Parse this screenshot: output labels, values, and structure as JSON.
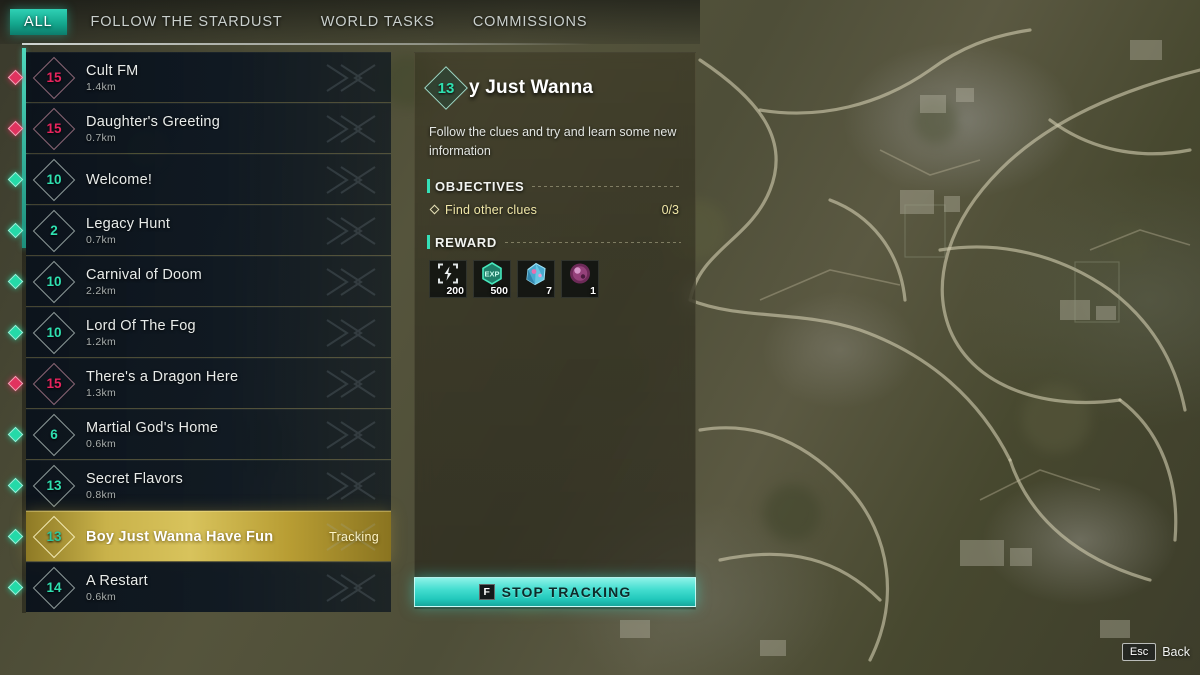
{
  "tabs": [
    {
      "label": "ALL",
      "active": true
    },
    {
      "label": "FOLLOW THE STARDUST",
      "active": false
    },
    {
      "label": "WORLD TASKS",
      "active": false
    },
    {
      "label": "COMMISSIONS",
      "active": false
    }
  ],
  "quests": [
    {
      "level": "15",
      "level_color": "red",
      "title": "Cult FM",
      "distance": "1.4km",
      "selected": false,
      "marker": "red"
    },
    {
      "level": "15",
      "level_color": "red",
      "title": "Daughter's Greeting",
      "distance": "0.7km",
      "selected": false,
      "marker": "red"
    },
    {
      "level": "10",
      "level_color": "teal",
      "title": "Welcome!",
      "distance": "",
      "selected": false,
      "marker": "teal"
    },
    {
      "level": "2",
      "level_color": "teal",
      "title": "Legacy Hunt",
      "distance": "0.7km",
      "selected": false,
      "marker": "teal"
    },
    {
      "level": "10",
      "level_color": "teal",
      "title": "Carnival of Doom",
      "distance": "2.2km",
      "selected": false,
      "marker": "teal"
    },
    {
      "level": "10",
      "level_color": "teal",
      "title": "Lord Of The Fog",
      "distance": "1.2km",
      "selected": false,
      "marker": "teal"
    },
    {
      "level": "15",
      "level_color": "red",
      "title": "There's a Dragon Here",
      "distance": "1.3km",
      "selected": false,
      "marker": "red"
    },
    {
      "level": "6",
      "level_color": "teal",
      "title": "Martial God's Home",
      "distance": "0.6km",
      "selected": false,
      "marker": "teal"
    },
    {
      "level": "13",
      "level_color": "teal",
      "title": "Secret Flavors",
      "distance": "0.8km",
      "selected": false,
      "marker": "teal"
    },
    {
      "level": "13",
      "level_color": "gold",
      "title": "Boy Just Wanna Have Fun",
      "distance": "",
      "selected": true,
      "marker": "teal",
      "tracking_label": "Tracking"
    },
    {
      "level": "14",
      "level_color": "teal",
      "title": "A Restart",
      "distance": "0.6km",
      "selected": false,
      "marker": "teal"
    }
  ],
  "detail": {
    "level": "13",
    "title": "y Just Wanna",
    "description": "Follow the clues and try and learn some new information",
    "objectives_header": "OBJECTIVES",
    "objectives": [
      {
        "label": "Find other clues",
        "progress": "0/3"
      }
    ],
    "reward_header": "REWARD",
    "rewards": [
      {
        "icon": "energy-bolt-icon",
        "qty": "200",
        "color": "#d8dde0"
      },
      {
        "icon": "exp-hexagon-icon",
        "qty": "500",
        "color": "#2fc79c"
      },
      {
        "icon": "blue-crystal-icon",
        "qty": "7",
        "color": "#6fc9e8"
      },
      {
        "icon": "purple-orb-icon",
        "qty": "1",
        "color": "#b濃"
      }
    ]
  },
  "stop_tracking": {
    "key": "F",
    "label": "STOP TRACKING"
  },
  "back_hint": {
    "key": "Esc",
    "label": "Back"
  },
  "colors": {
    "accent_teal": "#2fe0b0",
    "selected_gold": "#d8c35c",
    "level_red": "#e8245e",
    "objective_yellow": "#f0e7a8",
    "button_cyan": "#45ded0"
  }
}
